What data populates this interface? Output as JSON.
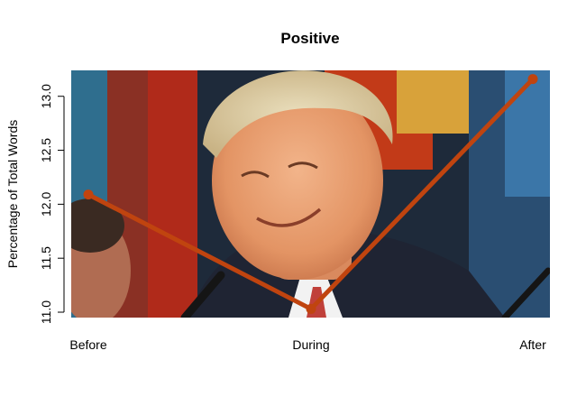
{
  "chart_data": {
    "type": "line",
    "title": "Positive",
    "xlabel": "",
    "ylabel": "Percentage of Total Words",
    "categories": [
      "Before",
      "During",
      "After"
    ],
    "series": [
      {
        "values": [
          12.09,
          11.03,
          13.16
        ],
        "color": "#c0440f"
      }
    ],
    "ylim": [
      10.95,
      13.24
    ],
    "yticks": [
      "11.0",
      "11.5",
      "12.0",
      "12.5",
      "13.0"
    ],
    "grid": false,
    "background": "photo of a smiling man in a dark suit"
  }
}
